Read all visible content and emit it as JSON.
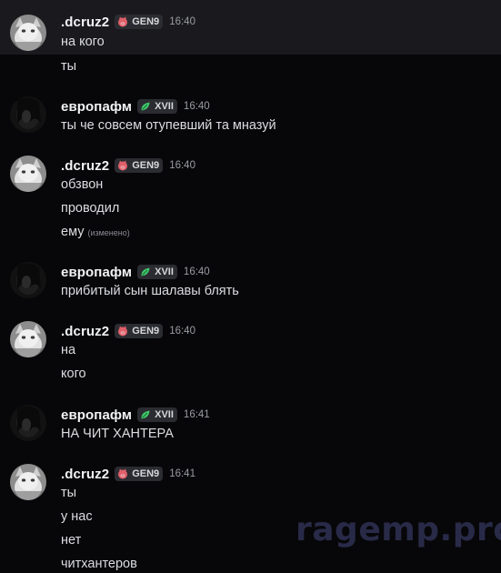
{
  "watermark": "ragemp.pro",
  "messages": [
    {
      "username": ".dcruz2",
      "badge": "GEN9",
      "badge_icon": "pink-pig-icon",
      "time": "16:40",
      "lines": [
        "на кого",
        "ты"
      ]
    },
    {
      "username": "европафм",
      "badge": "XVII",
      "badge_icon": "green-leaf-icon",
      "time": "16:40",
      "lines": [
        "ты че совсем отупевший та мназуй"
      ]
    },
    {
      "username": ".dcruz2",
      "badge": "GEN9",
      "badge_icon": "pink-pig-icon",
      "time": "16:40",
      "lines": [
        "обзвон",
        "проводил",
        "ему"
      ],
      "edited_label": "(изменено)"
    },
    {
      "username": "европафм",
      "badge": "XVII",
      "badge_icon": "green-leaf-icon",
      "time": "16:40",
      "lines": [
        "прибитый сын шалавы блять"
      ]
    },
    {
      "username": ".dcruz2",
      "badge": "GEN9",
      "badge_icon": "pink-pig-icon",
      "time": "16:40",
      "lines": [
        "на",
        "кого"
      ]
    },
    {
      "username": "европафм",
      "badge": "XVII",
      "badge_icon": "green-leaf-icon",
      "time": "16:41",
      "lines": [
        "НА ЧИТ ХАНТЕРА"
      ]
    },
    {
      "username": ".dcruz2",
      "badge": "GEN9",
      "badge_icon": "pink-pig-icon",
      "time": "16:41",
      "lines": [
        "ты",
        "у нас",
        "нет",
        "читхантеров"
      ]
    }
  ],
  "colors": {
    "background": "#070709",
    "highlight_row": "#1a1a1e",
    "username": "#f2f3f5",
    "message_text": "#dcdde1",
    "timestamp": "#9a9ca3",
    "badge_bg": "#2b2c31",
    "gen9_icon": "#e0606a",
    "xvii_icon": "#3fc76a",
    "watermark": "#2a2c4c"
  }
}
